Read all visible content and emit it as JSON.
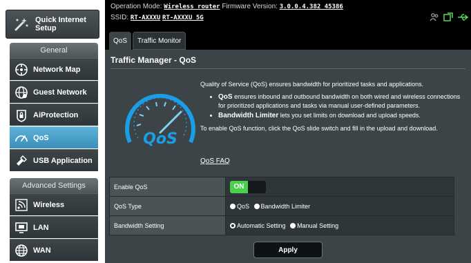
{
  "sidebar": {
    "quick_internet_setup": "Quick Internet Setup",
    "general_header": "General",
    "general_items": [
      {
        "label": "Network Map",
        "icon": "network-map-icon"
      },
      {
        "label": "Guest Network",
        "icon": "guest-network-icon"
      },
      {
        "label": "AiProtection",
        "icon": "lock-icon"
      },
      {
        "label": "QoS",
        "icon": "speedometer-icon",
        "active": true
      },
      {
        "label": "USB Application",
        "icon": "puzzle-icon"
      }
    ],
    "advanced_header": "Advanced Settings",
    "advanced_items": [
      {
        "label": "Wireless",
        "icon": "wireless-icon"
      },
      {
        "label": "LAN",
        "icon": "lan-icon"
      },
      {
        "label": "WAN",
        "icon": "globe-icon"
      }
    ]
  },
  "topbar": {
    "operation_mode_label": "Operation Mode:",
    "operation_mode_value": "Wireless router",
    "firmware_label": "Firmware Version:",
    "firmware_value": "3.0.0.4.382_45386",
    "ssid_label": "SSID:",
    "ssid_1": "RT-AXXXU",
    "ssid_2": "RT-AXXXU_5G",
    "icons": [
      "users-icon",
      "network-status-icon",
      "usb-icon"
    ]
  },
  "tabs": [
    "QoS",
    "Traffic Monitor"
  ],
  "main": {
    "title": "Traffic Manager - QoS",
    "intro": "Quality of Service (QoS) ensures bandwidth for prioritized tasks and applications.",
    "bullet1_bold": "QoS",
    "bullet1_text": " ensures inbound and outbound bandwidth on both wired and wireless connections for prioritized applications and tasks via manual user-defined parameters.",
    "bullet2_bold": "Bandwidth Limiter",
    "bullet2_text": " lets you set limits on download and upload speeds.",
    "enable_hint": "To enable QoS function, click the QoS slide switch and fill in the upload and download.",
    "faq_link": "QoS FAQ",
    "speedo_text": "QoS"
  },
  "settings": {
    "enable_qos_label": "Enable QoS",
    "enable_qos_state": "ON",
    "qos_type_label": "QoS Type",
    "qos_type_options": [
      "QoS",
      "Bandwidth Limiter"
    ],
    "bandwidth_label": "Bandwidth Setting",
    "bandwidth_options": [
      "Automatic Setting",
      "Manual Setting"
    ],
    "bandwidth_selected": "Automatic Setting"
  },
  "apply_label": "Apply",
  "colors": {
    "active_menu": "#3b8fbc",
    "toggle_on": "#4bd04b",
    "speedo_blue": "#1c9ee6"
  }
}
